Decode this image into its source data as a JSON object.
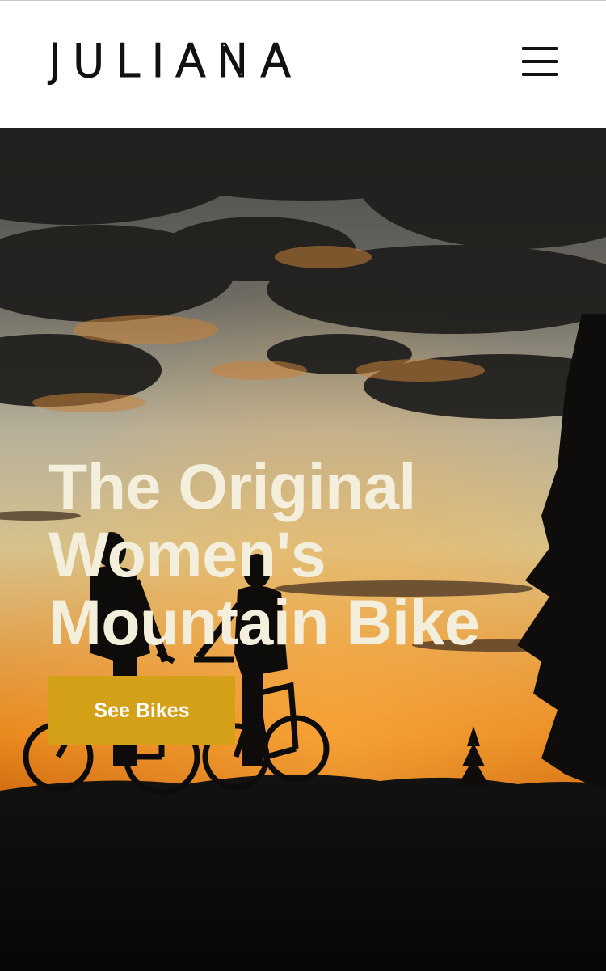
{
  "header": {
    "logo_text": "JULIANA"
  },
  "hero": {
    "headline_lines": [
      "The Original",
      "Women's",
      "Mountain Bike"
    ],
    "cta_label": "See Bikes"
  },
  "colors": {
    "header_bg": "#ffffff",
    "headline_text": "#f3efdc",
    "cta_bg": "#d4a017",
    "cta_text": "#ffffff"
  },
  "icons": {
    "menu": "hamburger-menu-icon"
  }
}
